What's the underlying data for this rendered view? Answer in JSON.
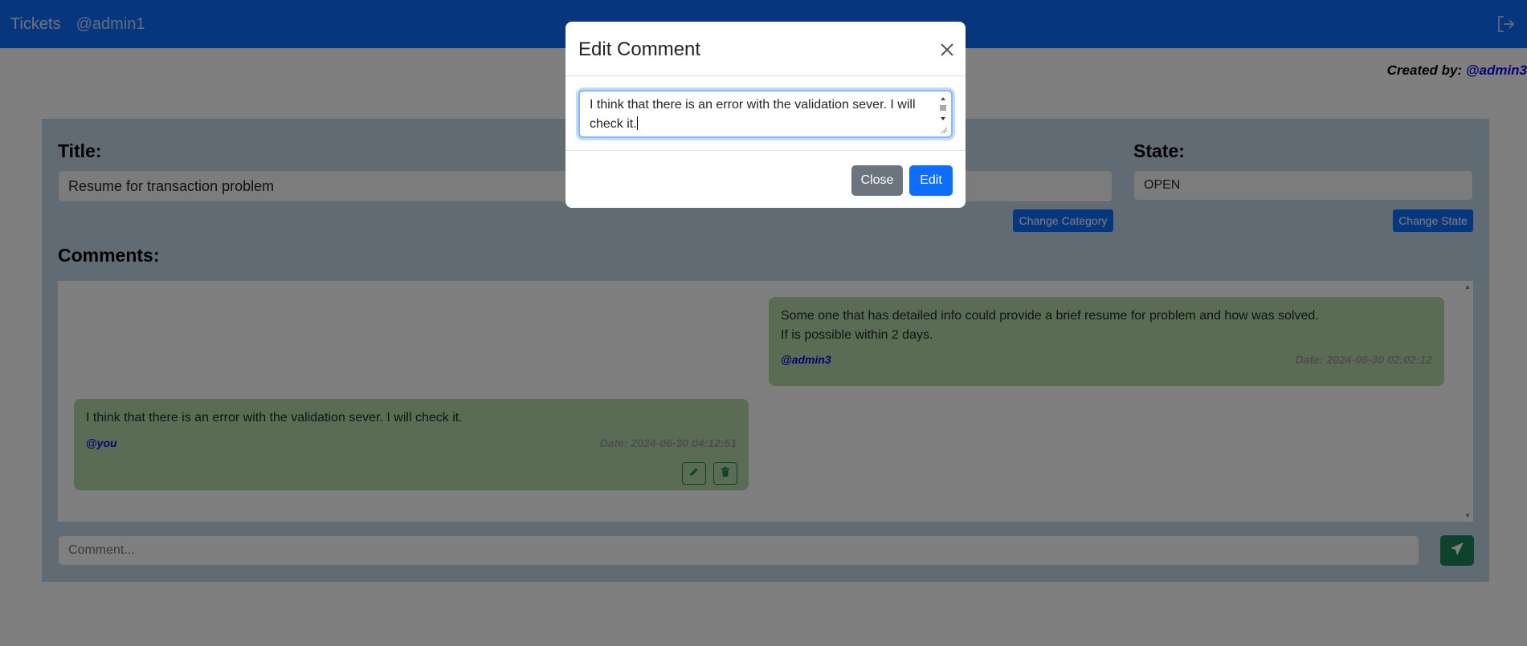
{
  "navbar": {
    "brand": "Tickets",
    "user": "@admin1",
    "logout_icon": "logout-icon",
    "bg_color": "#0d6efd"
  },
  "ticket": {
    "created_by_label": "Created by:",
    "created_by_user": "@admin3",
    "title_label": "Title:",
    "title_value": "Resume for transaction problem",
    "state_label": "State:",
    "state_value": "OPEN",
    "change_category_label": "Change Category",
    "change_state_label": "Change State"
  },
  "comments": {
    "label": "Comments:",
    "items": [
      {
        "lines": [
          "Some one that has detailed info could provide a brief resume for problem and how was solved.",
          "If is possible within 2 days."
        ],
        "author": "@admin3",
        "date": "Date: 2024-06-30 02:02:12"
      },
      {
        "lines": [
          "I think that there is an error with the validation sever. I will check it."
        ],
        "author": "@you",
        "date": "Date: 2024-06-30 04:12:51",
        "actions": [
          "pencil-icon",
          "trash-icon"
        ]
      }
    ],
    "input_placeholder": "Comment...",
    "send_icon": "send-icon",
    "bubble_color": "#b5dba9"
  },
  "modal": {
    "title": "Edit Comment",
    "text_line1": "I think that there is an error with the validation sever. I will",
    "text_line2": "check it.",
    "close_label": "Close",
    "edit_label": "Edit",
    "close_icon": "close-icon",
    "close_color": "#6c757d",
    "edit_color": "#0d6efd"
  }
}
